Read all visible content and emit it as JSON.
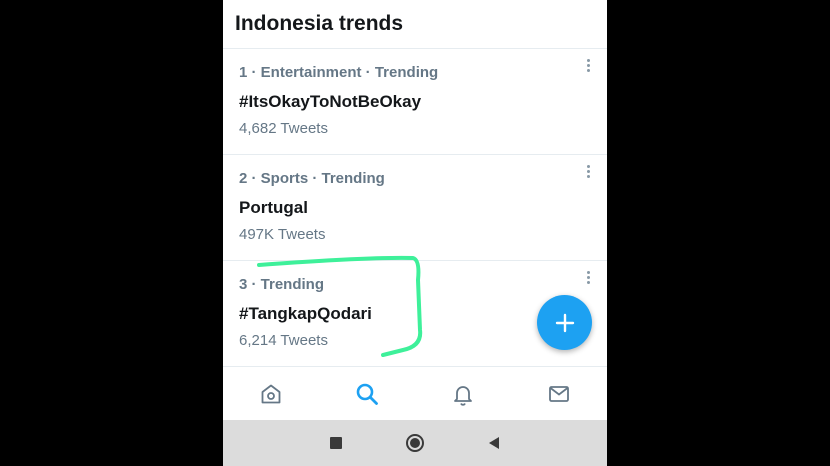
{
  "header": {
    "title": "Indonesia trends"
  },
  "trends": [
    {
      "meta": "1 · Entertainment · Trending",
      "name": "#ItsOkayToNotBeOkay",
      "count": "4,682 Tweets"
    },
    {
      "meta": "2 · Sports · Trending",
      "name": "Portugal",
      "count": "497K Tweets"
    },
    {
      "meta": "3 · Trending",
      "name": "#TangkapQodari",
      "count": "6,214 Tweets"
    }
  ],
  "icons": {
    "more": "more-vertical-icon",
    "compose": "plus-icon",
    "home": "home-icon",
    "search": "search-icon",
    "notifications": "bell-icon",
    "messages": "mail-icon",
    "recent_apps": "square-icon",
    "home_system": "circle-icon",
    "back": "triangle-back-icon"
  },
  "colors": {
    "accent": "#1da1f2",
    "highlight": "#3ef09a",
    "text_primary": "#14171a",
    "text_secondary": "#657786"
  }
}
